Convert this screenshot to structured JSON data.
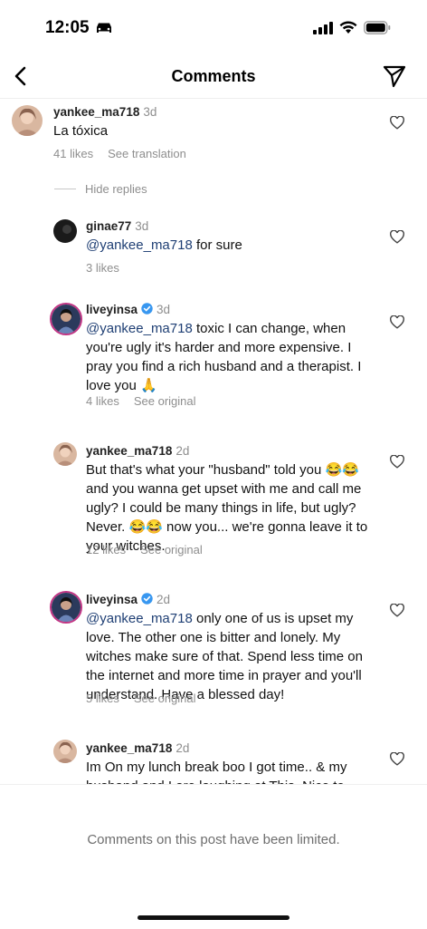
{
  "status": {
    "time": "12:05"
  },
  "header": {
    "title": "Comments"
  },
  "colors": {
    "mention": "#1f3f74",
    "muted": "#8e8e8e",
    "story_ring": "#c13584",
    "verified": "#3897f0"
  },
  "comments": [
    {
      "user": "yankee_ma718",
      "time": "3d",
      "text": "La tóxica",
      "likes": "41 likes",
      "action": "See translation"
    },
    {
      "user": "ginae77",
      "time": "3d",
      "mention": "@yankee_ma718",
      "text": " for sure",
      "likes": "3 likes"
    },
    {
      "user": "liveyinsa",
      "verified": true,
      "time": "3d",
      "mention": "@yankee_ma718",
      "text": " toxic I can change, when you're ugly it's harder and more expensive. I pray you find a rich husband and a therapist. I love you 🙏",
      "likes": "4 likes",
      "action": "See original"
    },
    {
      "user": "yankee_ma718",
      "time": "2d",
      "text": "But that's what your \"husband\" told you 😂😂 and you wanna get upset with me and call me ugly? I could be many things in life, but ugly? Never. 😂😂 now you... we're gonna leave it to your witches.",
      "likes": "12 likes",
      "action": "See original"
    },
    {
      "user": "liveyinsa",
      "verified": true,
      "time": "2d",
      "mention": "@yankee_ma718",
      "text": " only one of us is upset my love. The other one is bitter and lonely. My witches make sure of that. Spend less time on the internet and more time in prayer and you'll understand. Have a blessed day!",
      "likes": "5 likes",
      "action": "See original"
    },
    {
      "user": "yankee_ma718",
      "time": "2d",
      "text": "Im On my lunch break boo I got time.. & my husband and I are laughing at This. Nice to"
    }
  ],
  "replies_toggle": "Hide replies",
  "footer": {
    "limited": "Comments on this post have been limited."
  }
}
